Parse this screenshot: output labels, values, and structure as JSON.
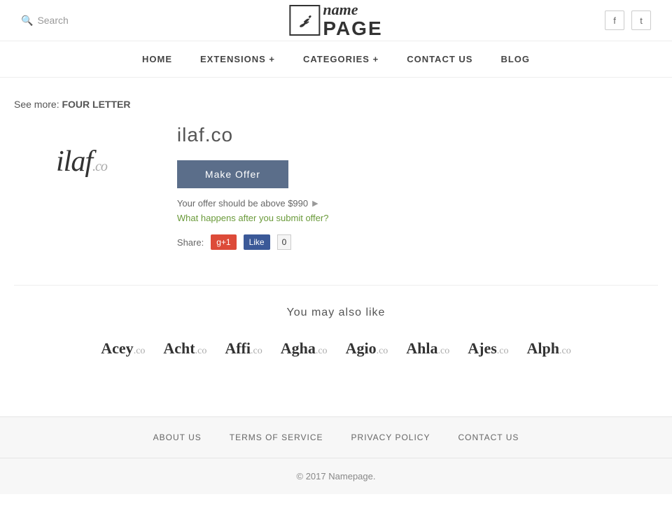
{
  "header": {
    "search_label": "Search",
    "logo_icon_char": "n",
    "logo_name": "name",
    "logo_page": "PAGE",
    "facebook_icon": "f",
    "twitter_icon": "t"
  },
  "nav": {
    "items": [
      {
        "label": "HOME",
        "id": "home"
      },
      {
        "label": "EXTENSIONS +",
        "id": "extensions"
      },
      {
        "label": "CATEGORIES +",
        "id": "categories"
      },
      {
        "label": "CONTACT US",
        "id": "contact"
      },
      {
        "label": "BLOG",
        "id": "blog"
      }
    ]
  },
  "content": {
    "see_more_label": "See more:",
    "see_more_link": "FOUR LETTER",
    "domain_name": "ilaf",
    "domain_tld": ".co",
    "domain_full": "ilaf.co",
    "make_offer_label": "Make Offer",
    "offer_info": "Your offer should be above $990",
    "what_happens": "What happens after you submit offer?",
    "share_label": "Share:",
    "gplus_label": "g+1",
    "fb_like_label": "Like",
    "fb_count": "0"
  },
  "suggestions": {
    "title": "You may also like",
    "domains": [
      {
        "name": "Acey",
        "tld": ".co"
      },
      {
        "name": "Acht",
        "tld": ".co"
      },
      {
        "name": "Affi",
        "tld": ".co"
      },
      {
        "name": "Agha",
        "tld": ".co"
      },
      {
        "name": "Agio",
        "tld": ".co"
      },
      {
        "name": "Ahla",
        "tld": ".co"
      },
      {
        "name": "Ajes",
        "tld": ".co"
      },
      {
        "name": "Alph",
        "tld": ".co"
      }
    ]
  },
  "footer": {
    "links": [
      {
        "label": "ABOUT US",
        "id": "about"
      },
      {
        "label": "TERMS OF SERVICE",
        "id": "terms"
      },
      {
        "label": "PRIVACY POLICY",
        "id": "privacy"
      },
      {
        "label": "CONTACT US",
        "id": "contact"
      }
    ],
    "copyright": "© 2017",
    "brand_link": "Namepage.",
    "year": "2017"
  }
}
